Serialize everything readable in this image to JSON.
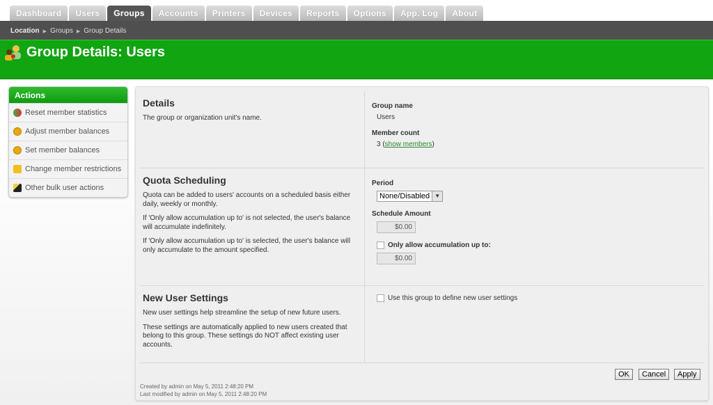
{
  "tabs": [
    {
      "label": "Dashboard"
    },
    {
      "label": "Users"
    },
    {
      "label": "Groups",
      "active": true
    },
    {
      "label": "Accounts"
    },
    {
      "label": "Printers"
    },
    {
      "label": "Devices"
    },
    {
      "label": "Reports"
    },
    {
      "label": "Options"
    },
    {
      "label": "App. Log"
    },
    {
      "label": "About"
    }
  ],
  "breadcrumb": {
    "root": "Location",
    "items": [
      "Groups",
      "Group Details"
    ]
  },
  "page_title": "Group Details: Users",
  "sidebar": {
    "title": "Actions",
    "items": [
      {
        "label": "Reset member statistics",
        "icon": "reset-icon"
      },
      {
        "label": "Adjust member balances",
        "icon": "coin-icon"
      },
      {
        "label": "Set member balances",
        "icon": "coin-icon"
      },
      {
        "label": "Change member restrictions",
        "icon": "padlock-icon"
      },
      {
        "label": "Other bulk user actions",
        "icon": "wand-icon"
      }
    ]
  },
  "details": {
    "title": "Details",
    "desc": "The group or organization unit's name.",
    "group_name_label": "Group name",
    "group_name": "Users",
    "member_count_label": "Member count",
    "member_count": "3",
    "show_members": "show members"
  },
  "quota": {
    "title": "Quota Scheduling",
    "desc": [
      "Quota can be added to users' accounts on a scheduled basis either daily, weekly or monthly.",
      "If 'Only allow accumulation up to' is not selected, the user's balance will accumulate indefinitely.",
      "If 'Only allow accumulation up to' is selected, the user's balance will only accumulate to the amount specified."
    ],
    "period_label": "Period",
    "period_value": "None/Disabled",
    "amount_label": "Schedule Amount",
    "amount_value": "$0.00",
    "accum_label": "Only allow accumulation up to:",
    "accum_checked": false,
    "accum_value": "$0.00"
  },
  "new_user": {
    "title": "New User Settings",
    "desc": [
      "New user settings help streamline the setup of new future users.",
      "These settings are automatically applied to new users created that belong to this group. These settings do NOT affect existing user accounts."
    ],
    "checkbox_label": "Use this group to define new user settings",
    "checked": false
  },
  "buttons": {
    "ok": "OK",
    "cancel": "Cancel",
    "apply": "Apply"
  },
  "footer": {
    "created": "Created by admin on May 5, 2011 2:48:20 PM",
    "modified": "Last modified by admin on May 5, 2011 2:48:20 PM"
  },
  "colors": {
    "brand_green": "#11a511",
    "header_dark": "#4f4f4f"
  }
}
